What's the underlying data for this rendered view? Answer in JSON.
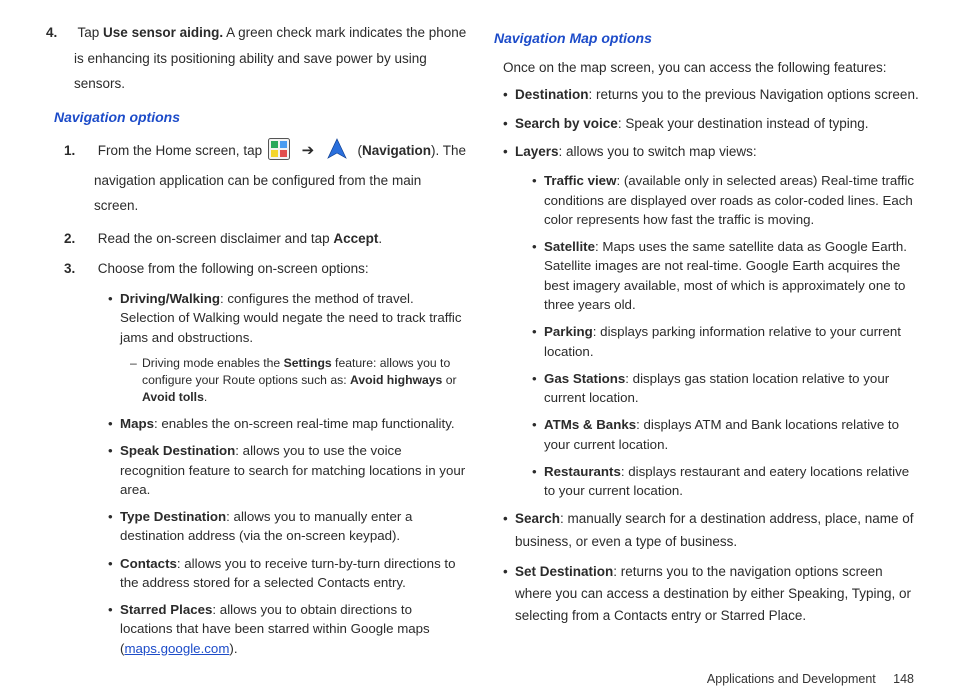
{
  "left": {
    "step4": {
      "num": "4.",
      "prefix": "Tap ",
      "bold": "Use sensor aiding.",
      "rest": " A green check mark indicates the phone is enhancing its positioning ability and save power by using sensors."
    },
    "heading": "Navigation options",
    "step1": {
      "num": "1.",
      "part1": "From the Home screen, tap ",
      "label": "Navigation",
      "part2": "The navigation application can be configured from the main screen."
    },
    "step2": {
      "num": "2.",
      "text_a": "Read the on-screen disclaimer and tap ",
      "accept": "Accept",
      "dot": "."
    },
    "step3": {
      "num": "3.",
      "text": "Choose from the following on-screen options:"
    },
    "bullets": {
      "driving": {
        "title": "Driving/Walking",
        "text": ": configures the method of travel. Selection of Walking would negate the need to track traffic jams and obstructions."
      },
      "dash": {
        "pre": "Driving mode enables the ",
        "settings": "Settings",
        "mid": " feature: allows you to configure your Route options such as: ",
        "ah": "Avoid highways",
        "or": " or ",
        "at": "Avoid tolls",
        "dot": "."
      },
      "maps": {
        "title": "Maps",
        "text": ": enables the on-screen real-time map functionality."
      },
      "speak": {
        "title": "Speak Destination",
        "text": ": allows you to use the voice recognition feature to search for matching locations in your area."
      },
      "type": {
        "title": "Type Destination",
        "text": ": allows you to manually enter a destination address (via the on-screen keypad)."
      },
      "contacts": {
        "title": "Contacts",
        "text": ": allows you to receive turn-by-turn directions to the address stored for a selected Contacts entry."
      },
      "starred": {
        "title": "Starred Places",
        "text": ": allows you to obtain directions to locations that have been starred within Google maps (",
        "link": "maps.google.com",
        "end": ")."
      }
    }
  },
  "right": {
    "heading": "Navigation Map options",
    "intro": "Once on the map screen, you can access the following features:",
    "destination": {
      "title": "Destination",
      "text": ": returns you to the previous Navigation options screen."
    },
    "sbv": {
      "title": "Search by voice",
      "text": ": Speak your destination instead of typing."
    },
    "layers": {
      "title": "Layers",
      "text": ": allows you to switch map views:"
    },
    "sub": {
      "traffic": {
        "title": "Traffic view",
        "text": ": (available only in selected areas) Real-time traffic conditions are displayed over roads as color-coded lines. Each color represents how fast the traffic is moving."
      },
      "satellite": {
        "title": "Satellite",
        "text": ": Maps uses the same satellite data as Google Earth. Satellite images are not real-time. Google Earth acquires the best imagery available, most of which is approximately one to three years old."
      },
      "parking": {
        "title": "Parking",
        "text": ": displays parking information relative to your current location."
      },
      "gas": {
        "title": "Gas Stations",
        "text": ": displays gas station location relative to your current location."
      },
      "atms": {
        "title": "ATMs & Banks",
        "text": ": displays ATM and Bank locations relative to your current location."
      },
      "restaurants": {
        "title": "Restaurants",
        "text": ": displays restaurant and eatery locations relative to your current location."
      }
    },
    "search": {
      "title": "Search",
      "text": ": manually search for a destination address, place, name of business, or even a type of business."
    },
    "setdest": {
      "title": "Set Destination",
      "text": ": returns you to the navigation options screen where you can access a destination by either Speaking, Typing, or selecting from a Contacts entry or Starred Place."
    }
  },
  "footer": {
    "section": "Applications and Development",
    "page": "148"
  }
}
